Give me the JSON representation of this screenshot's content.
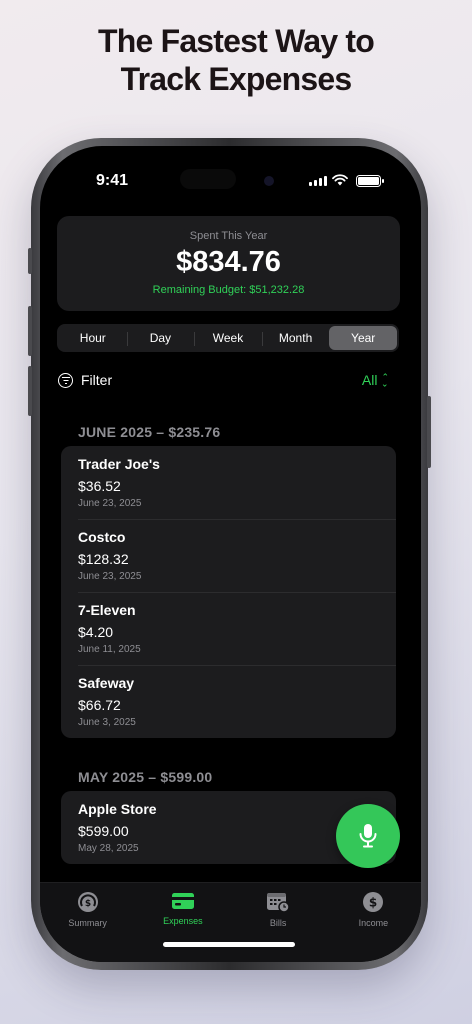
{
  "headline": {
    "line1": "The Fastest Way to",
    "line2": "Track Expenses"
  },
  "status_bar": {
    "time": "9:41"
  },
  "summary": {
    "label": "Spent This Year",
    "amount": "$834.76",
    "remaining": "Remaining Budget: $51,232.28"
  },
  "periods": [
    "Hour",
    "Day",
    "Week",
    "Month",
    "Year"
  ],
  "selected_period": "Year",
  "filter": {
    "label": "Filter",
    "value": "All"
  },
  "groups": [
    {
      "title": "JUNE 2025 – $235.76",
      "items": [
        {
          "name": "Trader Joe's",
          "amount": "$36.52",
          "date": "June 23, 2025"
        },
        {
          "name": "Costco",
          "amount": "$128.32",
          "date": "June 23, 2025"
        },
        {
          "name": "7-Eleven",
          "amount": "$4.20",
          "date": "June 11, 2025"
        },
        {
          "name": "Safeway",
          "amount": "$66.72",
          "date": "June 3, 2025"
        }
      ]
    },
    {
      "title": "MAY 2025 – $599.00",
      "items": [
        {
          "name": "Apple Store",
          "amount": "$599.00",
          "date": "May 28, 2025"
        }
      ]
    }
  ],
  "tabs": [
    {
      "label": "Summary",
      "icon": "gauge-dollar-icon"
    },
    {
      "label": "Expenses",
      "icon": "credit-card-icon"
    },
    {
      "label": "Bills",
      "icon": "calendar-clock-icon"
    },
    {
      "label": "Income",
      "icon": "dollar-circle-icon"
    }
  ],
  "active_tab": "Expenses",
  "colors": {
    "accent": "#30d158",
    "fab": "#34c759",
    "card": "#1c1c1e",
    "secondary_text": "#8e8e93"
  }
}
